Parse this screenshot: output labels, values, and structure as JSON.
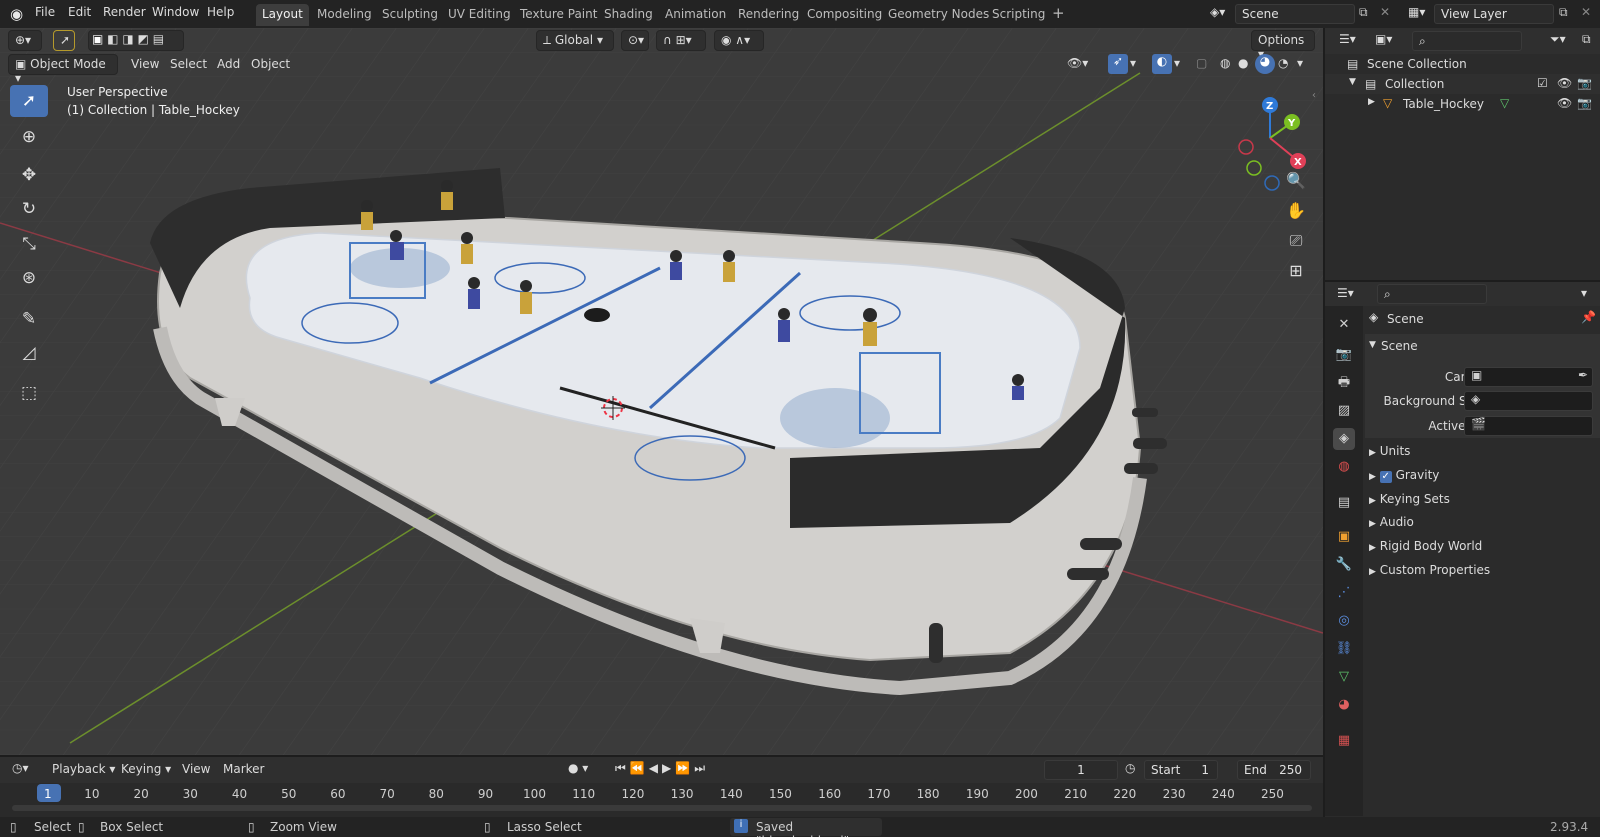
{
  "app": {
    "title": "Blender",
    "version": "2.93.4"
  },
  "menu": [
    "File",
    "Edit",
    "Render",
    "Window",
    "Help"
  ],
  "workspaces": [
    "Layout",
    "Modeling",
    "Sculpting",
    "UV Editing",
    "Texture Paint",
    "Shading",
    "Animation",
    "Rendering",
    "Compositing",
    "Geometry Nodes",
    "Scripting"
  ],
  "active_workspace": "Layout",
  "scene_field": "Scene",
  "view_layer_field": "View Layer",
  "viewport": {
    "mode": "Object Mode",
    "menus": [
      "View",
      "Select",
      "Add",
      "Object"
    ],
    "transform_orientation": "Global",
    "options_label": "Options",
    "overlay_line1": "User Perspective",
    "overlay_line2": "(1) Collection | Table_Hockey",
    "gizmo_axes": [
      "Z",
      "Y",
      "X"
    ]
  },
  "outliner": {
    "search_placeholder": "",
    "items": [
      {
        "label": "Scene Collection",
        "level": 0
      },
      {
        "label": "Collection",
        "level": 1
      },
      {
        "label": "Table_Hockey",
        "level": 2
      }
    ]
  },
  "properties": {
    "context": "Scene",
    "panel_title": "Scene",
    "camera_label": "Camera",
    "background_label": "Background Sce...",
    "active_clip_label": "Active Clip",
    "sections": [
      "Units",
      "Gravity",
      "Keying Sets",
      "Audio",
      "Rigid Body World",
      "Custom Properties"
    ],
    "gravity_checked": true
  },
  "timeline": {
    "menus": [
      "Playback",
      "Keying",
      "View",
      "Marker"
    ],
    "current_frame": "1",
    "start_label": "Start",
    "start_value": "1",
    "end_label": "End",
    "end_value": "250",
    "ticks": [
      "1",
      "10",
      "20",
      "30",
      "40",
      "50",
      "60",
      "70",
      "80",
      "90",
      "100",
      "110",
      "120",
      "130",
      "140",
      "150",
      "160",
      "170",
      "180",
      "190",
      "200",
      "210",
      "220",
      "230",
      "240",
      "250"
    ]
  },
  "statusbar": {
    "select": "Select",
    "box_select": "Box Select",
    "zoom_view": "Zoom View",
    "lasso_select": "Lasso Select",
    "message": "Saved \"blender.blend\"",
    "version": "2.93.4"
  },
  "colors": {
    "accent": "#4772b3",
    "axis_x": "#ff3352",
    "axis_y": "#8bdc00",
    "axis_z": "#2890ff"
  }
}
